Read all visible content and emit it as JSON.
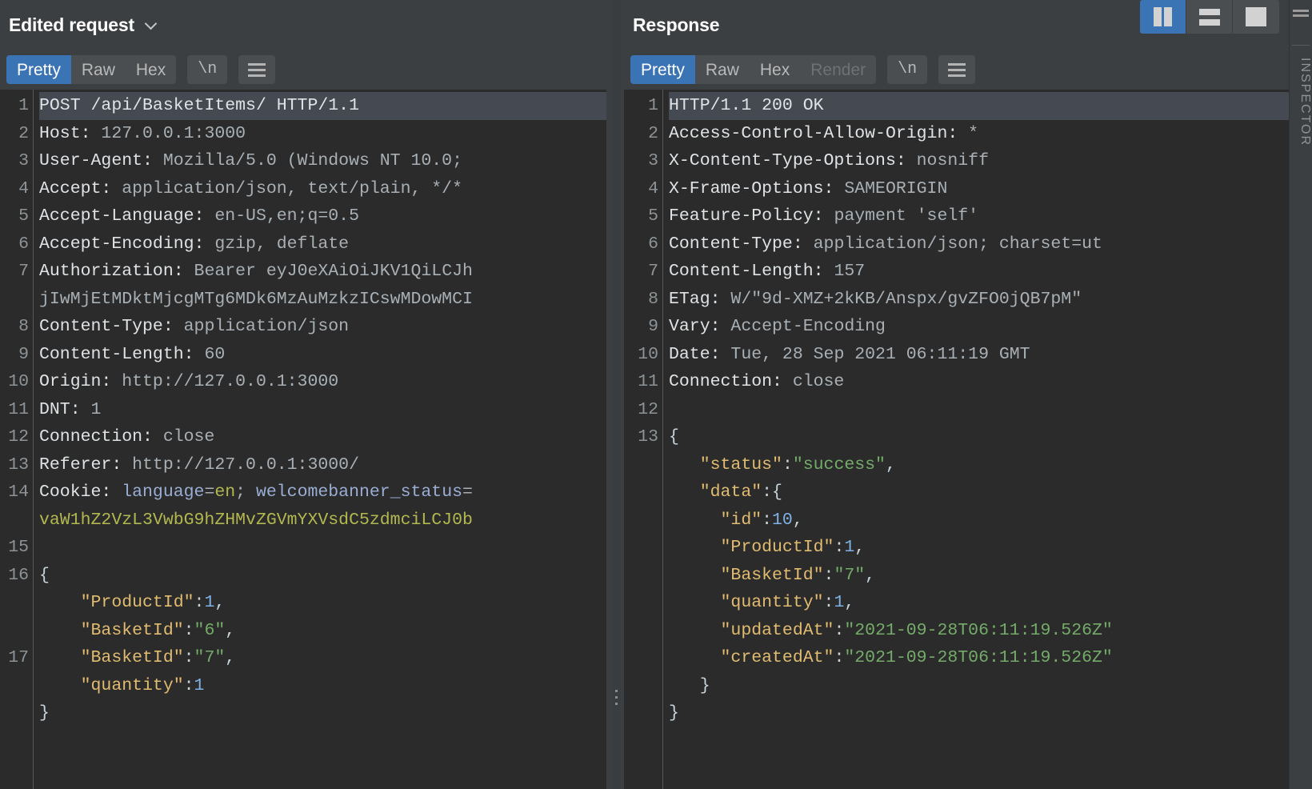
{
  "layout_buttons": [
    {
      "name": "side-by-side",
      "active": true
    },
    {
      "name": "top-bottom",
      "active": false
    },
    {
      "name": "single",
      "active": false
    }
  ],
  "inspector": {
    "label": "INSPECTOR"
  },
  "request": {
    "title": "Edited request",
    "caret": "chevron-down",
    "tabs": [
      {
        "label": "Pretty",
        "active": true
      },
      {
        "label": "Raw",
        "active": false
      },
      {
        "label": "Hex",
        "active": false
      }
    ],
    "newline_button": "\\n",
    "menu_button": "hamburger",
    "lines": [
      {
        "n": "1",
        "hl": true,
        "parts": [
          {
            "t": "POST /api/BasketItems/ HTTP/1.1",
            "c": "hdr"
          }
        ]
      },
      {
        "n": "2",
        "hl": false,
        "parts": [
          {
            "t": "Host: ",
            "c": "hdr"
          },
          {
            "t": "127.0.0.1:3000",
            "c": "val"
          }
        ]
      },
      {
        "n": "3",
        "hl": false,
        "parts": [
          {
            "t": "User-Agent: ",
            "c": "hdr"
          },
          {
            "t": "Mozilla/5.0 (Windows NT 10.0;",
            "c": "val"
          }
        ]
      },
      {
        "n": "4",
        "hl": false,
        "parts": [
          {
            "t": "Accept: ",
            "c": "hdr"
          },
          {
            "t": "application/json, text/plain, */*",
            "c": "val"
          }
        ]
      },
      {
        "n": "5",
        "hl": false,
        "parts": [
          {
            "t": "Accept-Language: ",
            "c": "hdr"
          },
          {
            "t": "en-US,en;q=0.5",
            "c": "val"
          }
        ]
      },
      {
        "n": "6",
        "hl": false,
        "parts": [
          {
            "t": "Accept-Encoding: ",
            "c": "hdr"
          },
          {
            "t": "gzip, deflate",
            "c": "val"
          }
        ]
      },
      {
        "n": "7",
        "hl": false,
        "parts": [
          {
            "t": "Authorization: ",
            "c": "hdr"
          },
          {
            "t": "Bearer eyJ0eXAiOiJKV1QiLCJh",
            "c": "val"
          }
        ]
      },
      {
        "n": "",
        "hl": false,
        "parts": [
          {
            "t": "jIwMjEtMDktMjcgMTg6MDk6MzAuMzkzICswMDowMCI",
            "c": "val"
          }
        ]
      },
      {
        "n": "8",
        "hl": false,
        "parts": [
          {
            "t": "Content-Type: ",
            "c": "hdr"
          },
          {
            "t": "application/json",
            "c": "val"
          }
        ]
      },
      {
        "n": "9",
        "hl": false,
        "parts": [
          {
            "t": "Content-Length: ",
            "c": "hdr"
          },
          {
            "t": "60",
            "c": "val"
          }
        ]
      },
      {
        "n": "10",
        "hl": false,
        "parts": [
          {
            "t": "Origin: ",
            "c": "hdr"
          },
          {
            "t": "http://127.0.0.1:3000",
            "c": "val"
          }
        ]
      },
      {
        "n": "11",
        "hl": false,
        "parts": [
          {
            "t": "DNT: ",
            "c": "hdr"
          },
          {
            "t": "1",
            "c": "val"
          }
        ]
      },
      {
        "n": "12",
        "hl": false,
        "parts": [
          {
            "t": "Connection: ",
            "c": "hdr"
          },
          {
            "t": "close",
            "c": "val"
          }
        ]
      },
      {
        "n": "13",
        "hl": false,
        "parts": [
          {
            "t": "Referer: ",
            "c": "hdr"
          },
          {
            "t": "http://127.0.0.1:3000/",
            "c": "val"
          }
        ]
      },
      {
        "n": "14",
        "hl": false,
        "parts": [
          {
            "t": "Cookie: ",
            "c": "hdr"
          },
          {
            "t": "language",
            "c": "ckey"
          },
          {
            "t": "=",
            "c": "val"
          },
          {
            "t": "en",
            "c": "cval"
          },
          {
            "t": "; ",
            "c": "val"
          },
          {
            "t": "welcomebanner_status",
            "c": "ckey"
          },
          {
            "t": "=",
            "c": "val"
          }
        ]
      },
      {
        "n": "",
        "hl": false,
        "parts": [
          {
            "t": "vaW1hZ2VzL3VwbG9hZHMvZGVmYXVsdC5zdmciLCJ0b",
            "c": "b64"
          }
        ]
      },
      {
        "n": "15",
        "hl": false,
        "parts": [
          {
            "t": "",
            "c": "val"
          }
        ]
      },
      {
        "n": "16",
        "hl": false,
        "parts": [
          {
            "t": "{",
            "c": "jpun"
          }
        ]
      },
      {
        "n": "",
        "hl": false,
        "parts": [
          {
            "t": "    ",
            "c": "jpun"
          },
          {
            "t": "\"ProductId\"",
            "c": "jkey"
          },
          {
            "t": ":",
            "c": "jpun"
          },
          {
            "t": "1",
            "c": "jnum"
          },
          {
            "t": ",",
            "c": "jpun"
          }
        ]
      },
      {
        "n": "",
        "hl": false,
        "parts": [
          {
            "t": "    ",
            "c": "jpun"
          },
          {
            "t": "\"BasketId\"",
            "c": "jkey"
          },
          {
            "t": ":",
            "c": "jpun"
          },
          {
            "t": "\"6\"",
            "c": "jstr"
          },
          {
            "t": ",",
            "c": "jpun"
          }
        ]
      },
      {
        "n": "17",
        "hl": false,
        "parts": [
          {
            "t": "    ",
            "c": "jpun"
          },
          {
            "t": "\"BasketId\"",
            "c": "jkey"
          },
          {
            "t": ":",
            "c": "jpun"
          },
          {
            "t": "\"7\"",
            "c": "jstr"
          },
          {
            "t": ",",
            "c": "jpun"
          }
        ]
      },
      {
        "n": "",
        "hl": false,
        "parts": [
          {
            "t": "    ",
            "c": "jpun"
          },
          {
            "t": "\"quantity\"",
            "c": "jkey"
          },
          {
            "t": ":",
            "c": "jpun"
          },
          {
            "t": "1",
            "c": "jnum"
          }
        ]
      },
      {
        "n": "",
        "hl": false,
        "parts": [
          {
            "t": "}",
            "c": "jpun"
          }
        ]
      }
    ]
  },
  "response": {
    "title": "Response",
    "tabs": [
      {
        "label": "Pretty",
        "active": true,
        "disabled": false
      },
      {
        "label": "Raw",
        "active": false,
        "disabled": false
      },
      {
        "label": "Hex",
        "active": false,
        "disabled": false
      },
      {
        "label": "Render",
        "active": false,
        "disabled": true
      }
    ],
    "newline_button": "\\n",
    "menu_button": "hamburger",
    "lines": [
      {
        "n": "1",
        "hl": true,
        "parts": [
          {
            "t": "HTTP/1.1 200 OK",
            "c": "hdr"
          }
        ]
      },
      {
        "n": "2",
        "hl": false,
        "parts": [
          {
            "t": "Access-Control-Allow-Origin: ",
            "c": "hdr"
          },
          {
            "t": "*",
            "c": "val"
          }
        ]
      },
      {
        "n": "3",
        "hl": false,
        "parts": [
          {
            "t": "X-Content-Type-Options: ",
            "c": "hdr"
          },
          {
            "t": "nosniff",
            "c": "val"
          }
        ]
      },
      {
        "n": "4",
        "hl": false,
        "parts": [
          {
            "t": "X-Frame-Options: ",
            "c": "hdr"
          },
          {
            "t": "SAMEORIGIN",
            "c": "val"
          }
        ]
      },
      {
        "n": "5",
        "hl": false,
        "parts": [
          {
            "t": "Feature-Policy: ",
            "c": "hdr"
          },
          {
            "t": "payment 'self'",
            "c": "val"
          }
        ]
      },
      {
        "n": "6",
        "hl": false,
        "parts": [
          {
            "t": "Content-Type: ",
            "c": "hdr"
          },
          {
            "t": "application/json; charset=ut",
            "c": "val"
          }
        ]
      },
      {
        "n": "7",
        "hl": false,
        "parts": [
          {
            "t": "Content-Length: ",
            "c": "hdr"
          },
          {
            "t": "157",
            "c": "val"
          }
        ]
      },
      {
        "n": "8",
        "hl": false,
        "parts": [
          {
            "t": "ETag: ",
            "c": "hdr"
          },
          {
            "t": "W/\"9d-XMZ+2kKB/Anspx/gvZFO0jQB7pM\"",
            "c": "val"
          }
        ]
      },
      {
        "n": "9",
        "hl": false,
        "parts": [
          {
            "t": "Vary: ",
            "c": "hdr"
          },
          {
            "t": "Accept-Encoding",
            "c": "val"
          }
        ]
      },
      {
        "n": "10",
        "hl": false,
        "parts": [
          {
            "t": "Date: ",
            "c": "hdr"
          },
          {
            "t": "Tue, 28 Sep 2021 06:11:19 GMT",
            "c": "val"
          }
        ]
      },
      {
        "n": "11",
        "hl": false,
        "parts": [
          {
            "t": "Connection: ",
            "c": "hdr"
          },
          {
            "t": "close",
            "c": "val"
          }
        ]
      },
      {
        "n": "12",
        "hl": false,
        "parts": [
          {
            "t": "",
            "c": "val"
          }
        ]
      },
      {
        "n": "13",
        "hl": false,
        "parts": [
          {
            "t": "{",
            "c": "jpun"
          }
        ]
      },
      {
        "n": "",
        "hl": false,
        "parts": [
          {
            "t": "   ",
            "c": "jpun"
          },
          {
            "t": "\"status\"",
            "c": "jkey"
          },
          {
            "t": ":",
            "c": "jpun"
          },
          {
            "t": "\"success\"",
            "c": "jstr"
          },
          {
            "t": ",",
            "c": "jpun"
          }
        ]
      },
      {
        "n": "",
        "hl": false,
        "parts": [
          {
            "t": "   ",
            "c": "jpun"
          },
          {
            "t": "\"data\"",
            "c": "jkey"
          },
          {
            "t": ":{",
            "c": "jpun"
          }
        ]
      },
      {
        "n": "",
        "hl": false,
        "parts": [
          {
            "t": "     ",
            "c": "jpun"
          },
          {
            "t": "\"id\"",
            "c": "jkey"
          },
          {
            "t": ":",
            "c": "jpun"
          },
          {
            "t": "10",
            "c": "jnum"
          },
          {
            "t": ",",
            "c": "jpun"
          }
        ]
      },
      {
        "n": "",
        "hl": false,
        "parts": [
          {
            "t": "     ",
            "c": "jpun"
          },
          {
            "t": "\"ProductId\"",
            "c": "jkey"
          },
          {
            "t": ":",
            "c": "jpun"
          },
          {
            "t": "1",
            "c": "jnum"
          },
          {
            "t": ",",
            "c": "jpun"
          }
        ]
      },
      {
        "n": "",
        "hl": false,
        "parts": [
          {
            "t": "     ",
            "c": "jpun"
          },
          {
            "t": "\"BasketId\"",
            "c": "jkey"
          },
          {
            "t": ":",
            "c": "jpun"
          },
          {
            "t": "\"7\"",
            "c": "jstr"
          },
          {
            "t": ",",
            "c": "jpun"
          }
        ]
      },
      {
        "n": "",
        "hl": false,
        "parts": [
          {
            "t": "     ",
            "c": "jpun"
          },
          {
            "t": "\"quantity\"",
            "c": "jkey"
          },
          {
            "t": ":",
            "c": "jpun"
          },
          {
            "t": "1",
            "c": "jnum"
          },
          {
            "t": ",",
            "c": "jpun"
          }
        ]
      },
      {
        "n": "",
        "hl": false,
        "parts": [
          {
            "t": "     ",
            "c": "jpun"
          },
          {
            "t": "\"updatedAt\"",
            "c": "jkey"
          },
          {
            "t": ":",
            "c": "jpun"
          },
          {
            "t": "\"2021-09-28T06:11:19.526Z\"",
            "c": "jstr"
          }
        ]
      },
      {
        "n": "",
        "hl": false,
        "parts": [
          {
            "t": "     ",
            "c": "jpun"
          },
          {
            "t": "\"createdAt\"",
            "c": "jkey"
          },
          {
            "t": ":",
            "c": "jpun"
          },
          {
            "t": "\"2021-09-28T06:11:19.526Z\"",
            "c": "jstr"
          }
        ]
      },
      {
        "n": "",
        "hl": false,
        "parts": [
          {
            "t": "   }",
            "c": "jpun"
          }
        ]
      },
      {
        "n": "",
        "hl": false,
        "parts": [
          {
            "t": "}",
            "c": "jpun"
          }
        ]
      }
    ]
  }
}
